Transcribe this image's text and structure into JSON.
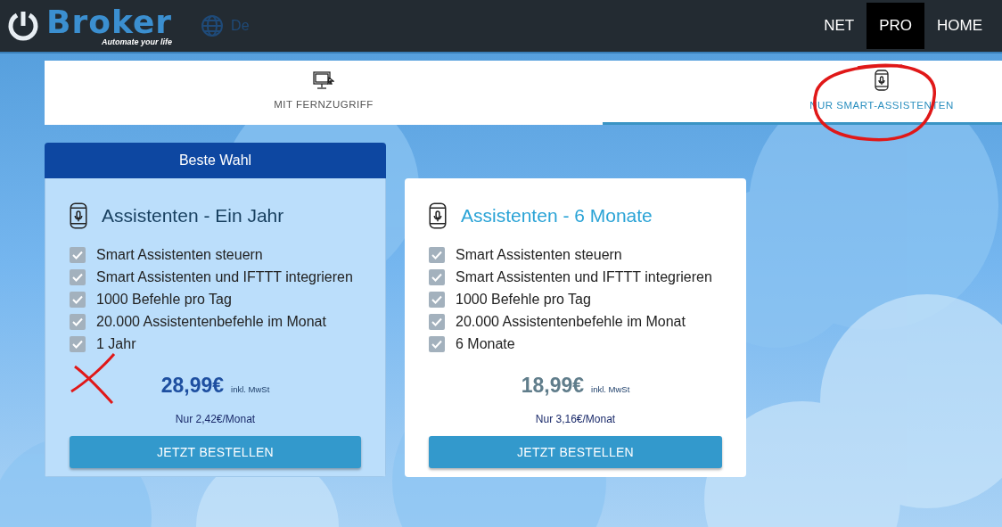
{
  "navbar": {
    "logo_text": "Broker",
    "logo_tagline": "Automate your life",
    "language": "De",
    "links": [
      {
        "label": "NET",
        "selected": false
      },
      {
        "label": "PRO",
        "selected": true
      },
      {
        "label": "HOME",
        "selected": false
      }
    ]
  },
  "tabs": [
    {
      "label": "MIT FERNZUGRIFF",
      "selected": false
    },
    {
      "label": "NUR SMART-ASSISTENTEN",
      "selected": true
    }
  ],
  "plans": [
    {
      "badge": "Beste Wahl",
      "highlighted": true,
      "title": "Assistenten - Ein Jahr",
      "features": [
        {
          "text": "Smart Assistenten steuern",
          "checked": true
        },
        {
          "text": "Smart Assistenten und IFTTT integrieren",
          "checked": true
        },
        {
          "text": "1000 Befehle pro Tag",
          "checked": true
        },
        {
          "text": "20.000 Assistentenbefehle im Monat",
          "checked": true
        },
        {
          "text": "1 Jahr",
          "checked": true
        }
      ],
      "price": "28,99€",
      "tax_note": "inkl. MwSt",
      "monthly": "Nur 2,42€/Monat",
      "button": "JETZT BESTELLEN"
    },
    {
      "highlighted": false,
      "title": "Assistenten - 6 Monate",
      "features": [
        {
          "text": "Smart Assistenten steuern",
          "checked": true
        },
        {
          "text": "Smart Assistenten und IFTTT integrieren",
          "checked": true
        },
        {
          "text": "1000 Befehle pro Tag",
          "checked": true
        },
        {
          "text": "20.000 Assistentenbefehle im Monat",
          "checked": true
        },
        {
          "text": "6 Monate",
          "checked": true
        }
      ],
      "price": "18,99€",
      "tax_note": "inkl. MwSt",
      "monthly": "Nur 3,16€/Monat",
      "button": "JETZT BESTELLEN"
    }
  ]
}
